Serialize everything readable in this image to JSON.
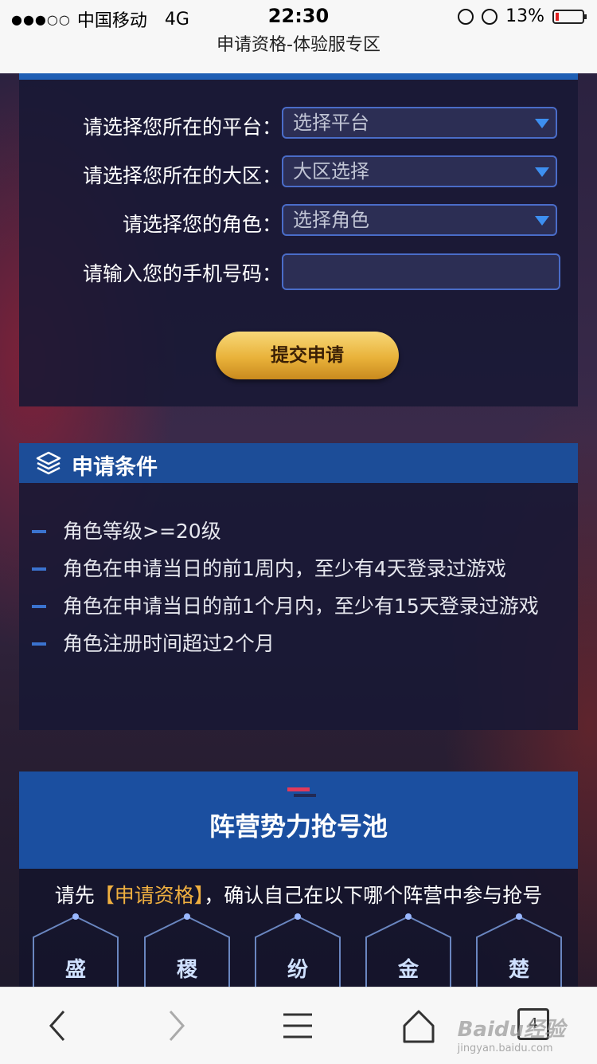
{
  "status_bar": {
    "signal": "●●●○○",
    "carrier": "中国移动",
    "network": "4G",
    "time": "22:30",
    "battery": "13%"
  },
  "page_title": "申请资格-体验服专区",
  "form": {
    "platform_label": "请选择您所在的平台：",
    "platform_value": "选择平台",
    "region_label": "请选择您所在的大区：",
    "region_value": "大区选择",
    "role_label": "请选择您的角色：",
    "role_value": "选择角色",
    "phone_label": "请输入您的手机号码：",
    "phone_value": "",
    "submit_label": "提交申请"
  },
  "conditions": {
    "title": "申请条件",
    "items": [
      "角色等级>=20级",
      "角色在申请当日的前1周内，至少有4天登录过游戏",
      "角色在申请当日的前1个月内，至少有15天登录过游戏",
      "角色注册时间超过2个月"
    ]
  },
  "pool": {
    "title": "阵营势力抢号池",
    "note_prefix": "请先",
    "note_link": "【申请资格】",
    "note_suffix": "，确认自己在以下哪个阵营中参与抢号",
    "factions": [
      "盛",
      "稷",
      "纷",
      "金",
      "楚"
    ]
  },
  "watermark": {
    "brand": "Baidu经验",
    "url": "jingyan.baidu.com"
  },
  "browser_nav": {
    "tab_count": "4"
  },
  "colors": {
    "accent_blue": "#1c4d98",
    "gold": "#e9b23a",
    "highlight": "#f0b040",
    "battery_low": "#e02020"
  }
}
